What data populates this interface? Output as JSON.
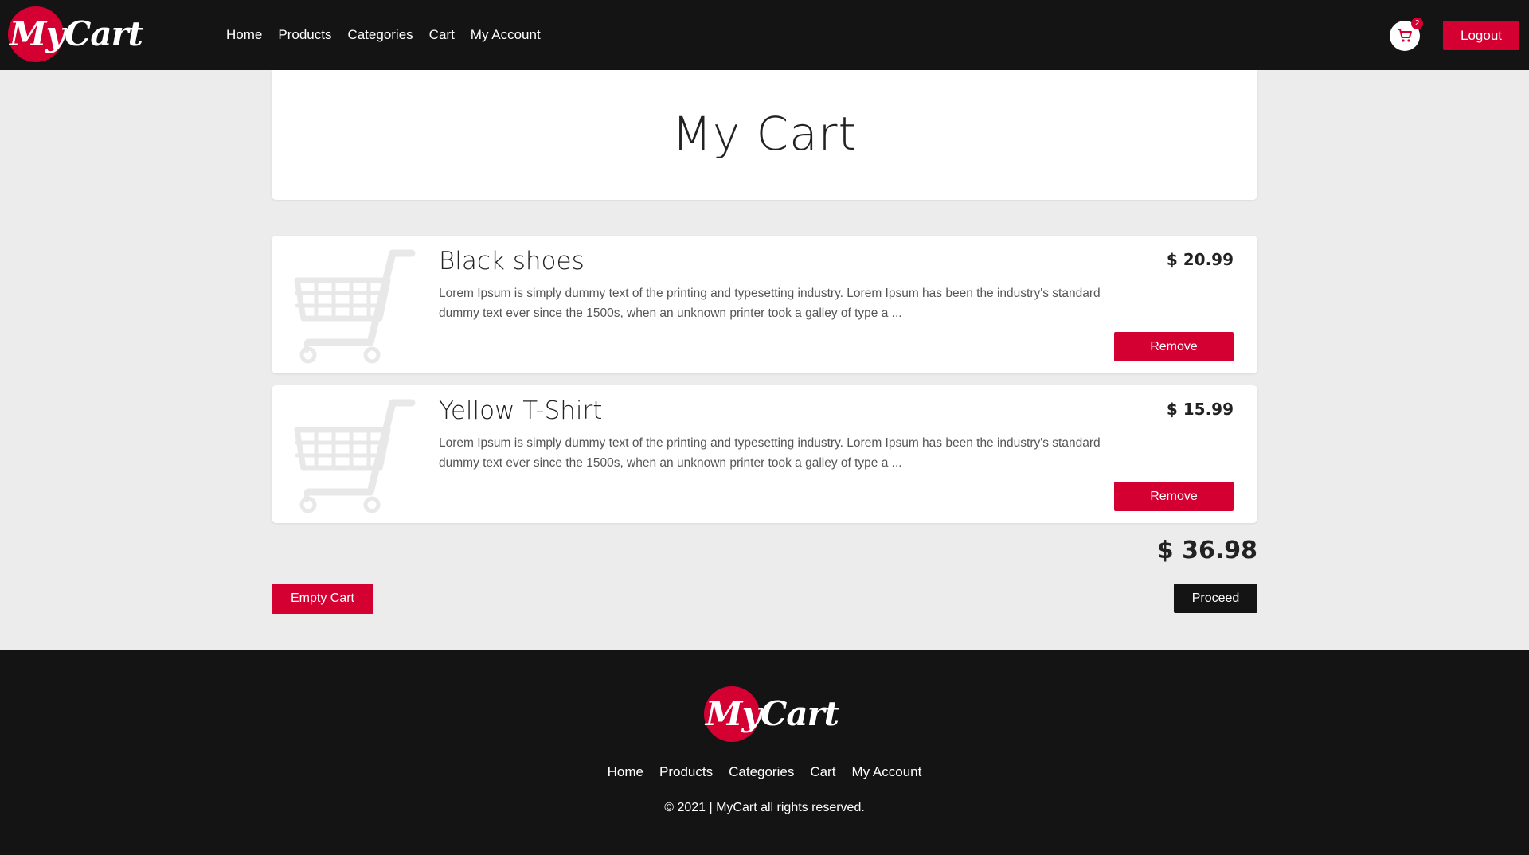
{
  "brand": {
    "logo_text": "MyCart",
    "accent_color": "#d50032",
    "dark_color": "#141414"
  },
  "header": {
    "nav": [
      "Home",
      "Products",
      "Categories",
      "Cart",
      "My Account"
    ],
    "cart_count": "2",
    "logout_label": "Logout"
  },
  "page": {
    "title": "My Cart"
  },
  "cart": {
    "items": [
      {
        "name": "Black shoes",
        "price": "$ 20.99",
        "description": "Lorem Ipsum is simply dummy text of the printing and typesetting industry. Lorem Ipsum has been the industry's standard dummy text ever since the 1500s, when an unknown printer took a galley of type a ...",
        "remove_label": "Remove",
        "thumbnail_icon": "shopping-cart-icon"
      },
      {
        "name": "Yellow T-Shirt",
        "price": "$ 15.99",
        "description": "Lorem Ipsum is simply dummy text of the printing and typesetting industry. Lorem Ipsum has been the industry's standard dummy text ever since the 1500s, when an unknown printer took a galley of type a ...",
        "remove_label": "Remove",
        "thumbnail_icon": "shopping-cart-icon"
      }
    ],
    "total": "$ 36.98",
    "empty_label": "Empty Cart",
    "proceed_label": "Proceed"
  },
  "footer": {
    "nav": [
      "Home",
      "Products",
      "Categories",
      "Cart",
      "My Account"
    ],
    "copyright": "© 2021 | MyCart all rights reserved."
  }
}
